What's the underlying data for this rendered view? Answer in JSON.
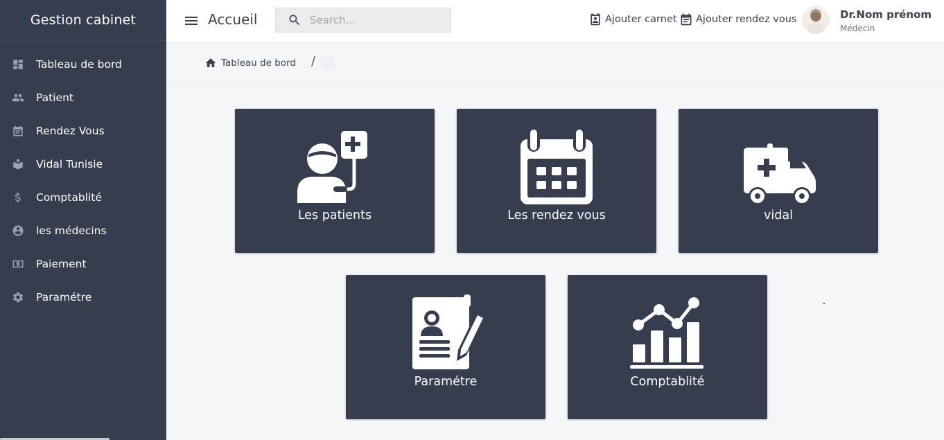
{
  "sidebar": {
    "brand": "Gestion cabinet",
    "items": [
      {
        "label": "Tableau de bord",
        "icon": "dashboard-icon"
      },
      {
        "label": "Patient",
        "icon": "people-icon"
      },
      {
        "label": "Rendez Vous",
        "icon": "calendar-icon"
      },
      {
        "label": "Vidal Tunisie",
        "icon": "book-icon"
      },
      {
        "label": "Comptablité",
        "icon": "dollar-icon"
      },
      {
        "label": "les médecins",
        "icon": "account-circle-icon"
      },
      {
        "label": "Paiement",
        "icon": "money-icon"
      },
      {
        "label": "Paramétre",
        "icon": "gear-icon"
      }
    ]
  },
  "header": {
    "title": "Accueil",
    "search": {
      "placeholder": "Search...",
      "value": ""
    },
    "actions": {
      "add_notebook": "Ajouter carnet",
      "add_appointment": "Ajouter rendez vous"
    },
    "user": {
      "name": "Dr.Nom prénom",
      "role": "Médecin"
    }
  },
  "breadcrumb": {
    "home": "Tableau de bord",
    "separator": "/"
  },
  "cards": [
    {
      "label": "Les patients",
      "icon": "patient-iv-icon"
    },
    {
      "label": "Les rendez vous",
      "icon": "calendar-grid-icon"
    },
    {
      "label": "vidal",
      "icon": "ambulance-icon"
    },
    {
      "label": "Paramétre",
      "icon": "profile-document-pen-icon"
    },
    {
      "label": "Comptablité",
      "icon": "bar-line-chart-icon"
    }
  ],
  "colors": {
    "sidebar_bg": "#363d4f",
    "card_bg": "#363d4f",
    "page_bg": "#f5f6f8",
    "header_bg": "#ffffff"
  }
}
